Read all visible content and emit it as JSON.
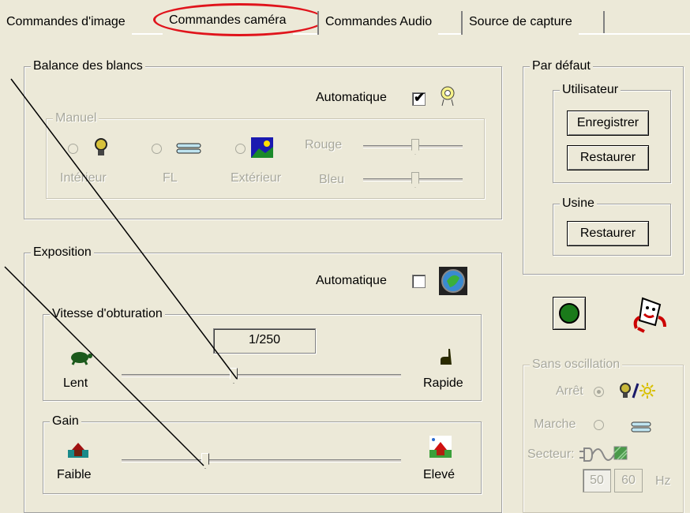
{
  "tabs": [
    {
      "label": "Commandes d'image"
    },
    {
      "label": "Commandes caméra"
    },
    {
      "label": "Commandes Audio"
    },
    {
      "label": "Source de capture"
    }
  ],
  "white_balance": {
    "title": "Balance des blancs",
    "auto_label": "Automatique",
    "auto_checked": true,
    "manual": {
      "title": "Manuel",
      "presets": [
        {
          "label": "Intérieur",
          "icon": "bulb-icon"
        },
        {
          "label": "FL",
          "icon": "fluorescent-tube-icon"
        },
        {
          "label": "Extérieur",
          "icon": "landscape-icon"
        }
      ],
      "red_label": "Rouge",
      "blue_label": "Bleu",
      "red_level": 0.52,
      "blue_level": 0.52
    }
  },
  "exposure": {
    "title": "Exposition",
    "auto_label": "Automatique",
    "auto_checked": false,
    "shutter": {
      "title": "Vitesse d'obturation",
      "value": "1/250",
      "min_label": "Lent",
      "max_label": "Rapide",
      "level": 0.4
    },
    "gain": {
      "title": "Gain",
      "min_label": "Faible",
      "max_label": "Elevé",
      "level": 0.3
    }
  },
  "defaults": {
    "title": "Par défaut",
    "user": {
      "title": "Utilisateur",
      "save_label": "Enregistrer",
      "restore_label": "Restaurer"
    },
    "factory": {
      "title": "Usine",
      "restore_label": "Restaurer"
    }
  },
  "flicker": {
    "title": "Sans oscillation",
    "off_label": "Arrêt",
    "on_label": "Marche",
    "mains_label": "Secteur:",
    "hz_50": "50",
    "hz_60": "60",
    "hz_unit": "Hz",
    "selected": "off"
  },
  "colors": {
    "background": "#ece9d8",
    "highlight_oval": "#e0141c",
    "record_green": "#1a7a1a"
  }
}
